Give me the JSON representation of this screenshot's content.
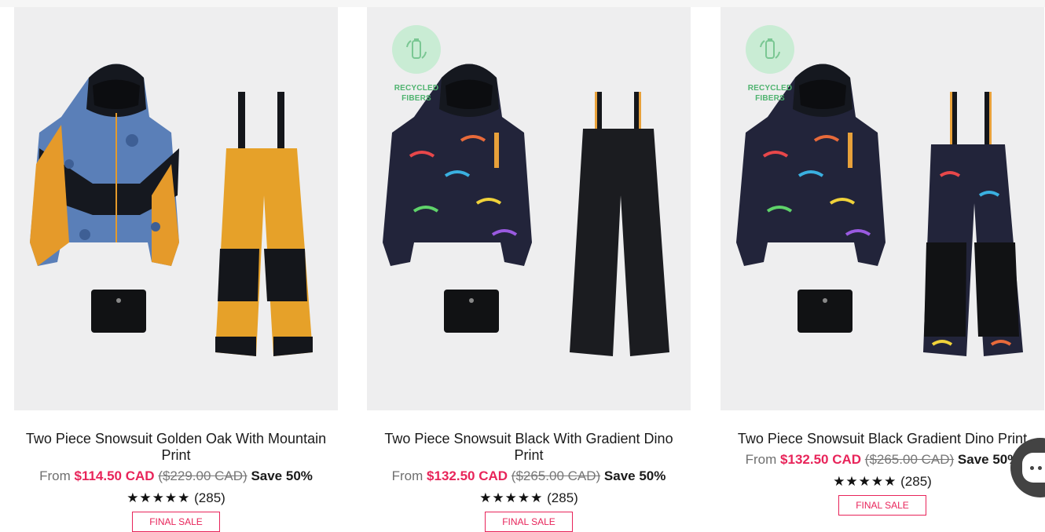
{
  "products": [
    {
      "title": "Two Piece Snowsuit Golden Oak With Mountain Print",
      "from_label": "From",
      "sale_price": "$114.50 CAD",
      "original_price": "($229.00 CAD)",
      "save": "Save 50%",
      "stars": "★★★★★",
      "rating": 5,
      "reviews": "(285)",
      "tag": "FINAL SALE",
      "recycled_badge": false,
      "jacket_colors": [
        "#5a7fb8",
        "#e59a2a",
        "#15181f"
      ],
      "pants_colors": [
        "#e6a129",
        "#14161b"
      ]
    },
    {
      "title": "Two Piece Snowsuit Black With Gradient Dino Print",
      "from_label": "From",
      "sale_price": "$132.50 CAD",
      "original_price": "($265.00 CAD)",
      "save": "Save 50%",
      "stars": "★★★★★",
      "rating": 5,
      "reviews": "(285)",
      "tag": "FINAL SALE",
      "recycled_badge": true,
      "badge_text": [
        "RECYCLED",
        "FIBERS"
      ],
      "jacket_colors": [
        "#22243a",
        "#e8a13a",
        "#111318"
      ],
      "pants_colors": [
        "#1b1c20",
        "#111214"
      ]
    },
    {
      "title": "Two Piece Snowsuit Black Gradient Dino Print",
      "from_label": "From",
      "sale_price": "$132.50 CAD",
      "original_price": "($265.00 CAD)",
      "save": "Save 50%",
      "stars": "★★★★★",
      "rating": 5,
      "reviews": "(285)",
      "tag": "FINAL SALE",
      "recycled_badge": true,
      "badge_text": [
        "RECYCLED",
        "FIBERS"
      ],
      "jacket_colors": [
        "#22243a",
        "#e8a13a",
        "#111318"
      ],
      "pants_colors": [
        "#22243a",
        "#111214"
      ]
    }
  ],
  "chat_widget": {
    "icon": "chat-icon"
  },
  "colors": {
    "sale": "#e8245a",
    "badge_bg": "#c9ecd4",
    "badge_text": "#4fb36f",
    "image_bg": "#eeeeef"
  }
}
